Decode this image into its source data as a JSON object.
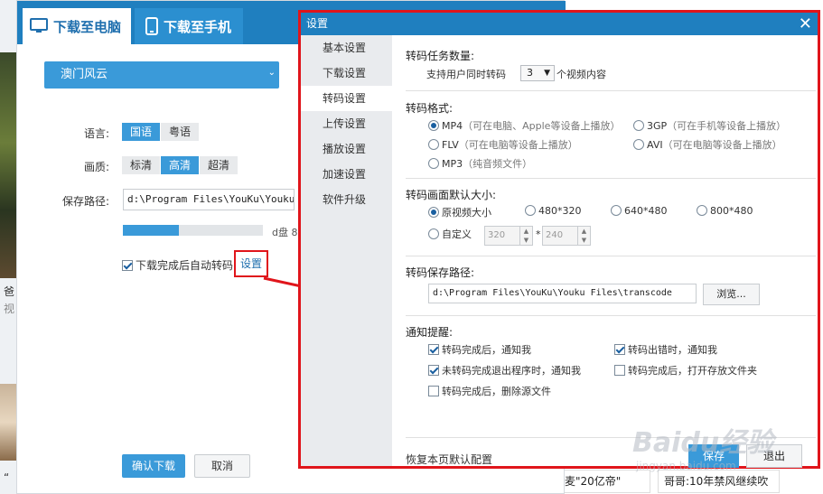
{
  "background": {
    "caption_top": "爸",
    "caption_sub": "视",
    "caption_bottom": "“",
    "news_left": "麦\"20亿帝\"",
    "news_right": "哥哥:10年禁风继续吹"
  },
  "download_dialog": {
    "tab_pc": "下载至电脑",
    "tab_phone": "下载至手机",
    "video_title": "澳门风云",
    "language_label": "语言:",
    "language_options": [
      "国语",
      "粤语"
    ],
    "language_selected": "国语",
    "quality_label": "画质:",
    "quality_options": [
      "标清",
      "高清",
      "超清"
    ],
    "quality_selected": "高清",
    "path_label": "保存路径:",
    "path_value": "d:\\Program Files\\YouKu\\Youku Files",
    "disk_info": "d盘 8",
    "disk_usage": 0.4,
    "auto_transcode_label": "下载完成后自动转码",
    "auto_transcode_checked": true,
    "settings_link": "设置",
    "confirm_button": "确认下载",
    "cancel_button": "取消"
  },
  "settings_dialog": {
    "title": "设置",
    "close_glyph": "✕",
    "nav": [
      "基本设置",
      "下载设置",
      "转码设置",
      "上传设置",
      "播放设置",
      "加速设置",
      "软件升级"
    ],
    "nav_active": "转码设置",
    "task_count": {
      "title": "转码任务数量:",
      "prefix": "支持用户同时转码",
      "value": "3",
      "suffix": "个视频内容"
    },
    "format": {
      "title": "转码格式:",
      "options": [
        {
          "name": "MP4",
          "hint": "（可在电脑、Apple等设备上播放）",
          "checked": true
        },
        {
          "name": "3GP",
          "hint": "（可在手机等设备上播放）",
          "checked": false
        },
        {
          "name": "FLV",
          "hint": "（可在电脑等设备上播放）",
          "checked": false
        },
        {
          "name": "AVI",
          "hint": "（可在电脑等设备上播放）",
          "checked": false
        },
        {
          "name": "MP3",
          "hint": "（纯音频文件）",
          "checked": false
        }
      ]
    },
    "size": {
      "title": "转码画面默认大小:",
      "options": [
        "原视频大小",
        "480*320",
        "640*480",
        "800*480"
      ],
      "selected": "原视频大小",
      "custom_label": "自定义",
      "custom_width": "320",
      "custom_height": "240",
      "times": "*"
    },
    "save_path": {
      "title": "转码保存路径:",
      "value": "d:\\Program Files\\YouKu\\Youku Files\\transcode",
      "browse": "浏览..."
    },
    "notify": {
      "title": "通知提醒:",
      "items": [
        {
          "label": "转码完成后，通知我",
          "checked": true
        },
        {
          "label": "转码出错时，通知我",
          "checked": true
        },
        {
          "label": "未转码完成退出程序时，通知我",
          "checked": true
        },
        {
          "label": "转码完成后，打开存放文件夹",
          "checked": false
        },
        {
          "label": "转码完成后，删除源文件",
          "checked": false
        }
      ]
    },
    "restore": "恢复本页默认配置",
    "save_button": "保存",
    "exit_button": "退出"
  },
  "watermark": {
    "main": "Baidu经验",
    "sub": "jingyan.baidu.com"
  },
  "colors": {
    "accent": "#3a9ad9",
    "title_bar": "#1f7fbf",
    "highlight": "#e0151b"
  }
}
